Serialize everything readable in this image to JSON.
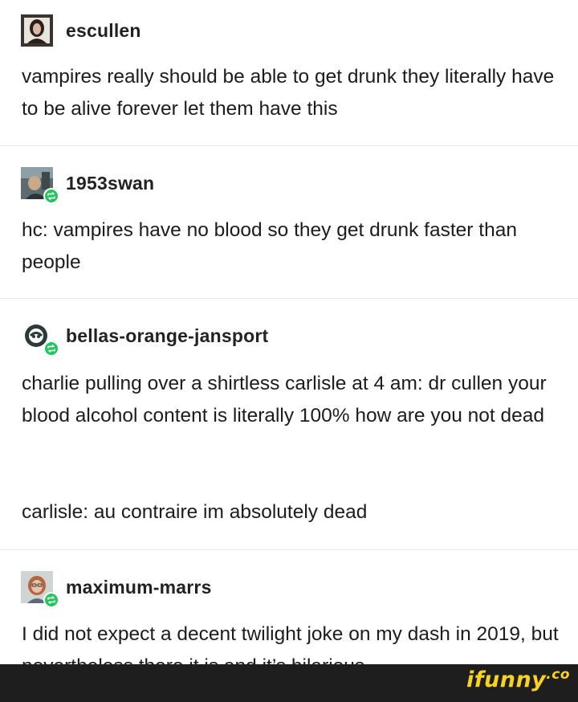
{
  "posts": [
    {
      "username": "escullen",
      "reblogged": false,
      "paragraphs": [
        "vampires really should be able to get drunk they literally have to be alive forever let them have this"
      ]
    },
    {
      "username": "1953swan",
      "reblogged": true,
      "paragraphs": [
        "hc: vampires have no blood so they get drunk faster than people"
      ]
    },
    {
      "username": "bellas-orange-jansport",
      "reblogged": true,
      "paragraphs": [
        "charlie pulling over a shirtless carlisle at 4 am: dr cullen your blood alcohol content is literally 100% how are you not dead",
        "carlisle: au contraire im absolutely dead"
      ]
    },
    {
      "username": "maximum-marrs",
      "reblogged": true,
      "paragraphs": [
        "I did not expect a decent twilight joke on my dash in 2019, but nevertheless there it is and it’s hilarious."
      ]
    }
  ],
  "watermark": {
    "text": "ifunny",
    "suffix": ".co"
  },
  "colors": {
    "reblog_badge": "#22c55e",
    "watermark": "#f7d21e",
    "footer_bar": "#1e1e1e"
  },
  "icons": {
    "reblog": "reblog-icon",
    "avatar": "avatar-icon"
  }
}
